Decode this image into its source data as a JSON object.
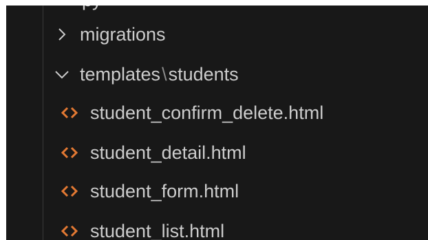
{
  "explorer": {
    "partial_item": {
      "label": "py"
    },
    "folders": [
      {
        "label": "migrations",
        "expanded": false,
        "icon": "chevron-right-icon"
      },
      {
        "label_parent": "templates",
        "separator": "\\",
        "label_child": "students",
        "expanded": true,
        "icon": "chevron-down-icon"
      }
    ],
    "files": [
      {
        "label": "student_confirm_delete.html",
        "icon": "html-file-icon"
      },
      {
        "label": "student_detail.html",
        "icon": "html-file-icon"
      },
      {
        "label": "student_form.html",
        "icon": "html-file-icon"
      },
      {
        "label": "student_list.html",
        "icon": "html-file-icon"
      }
    ]
  },
  "colors": {
    "background": "#181818",
    "text": "#cccccc",
    "html_icon": "#e37933",
    "indent_guide": "#3b3b3b"
  }
}
